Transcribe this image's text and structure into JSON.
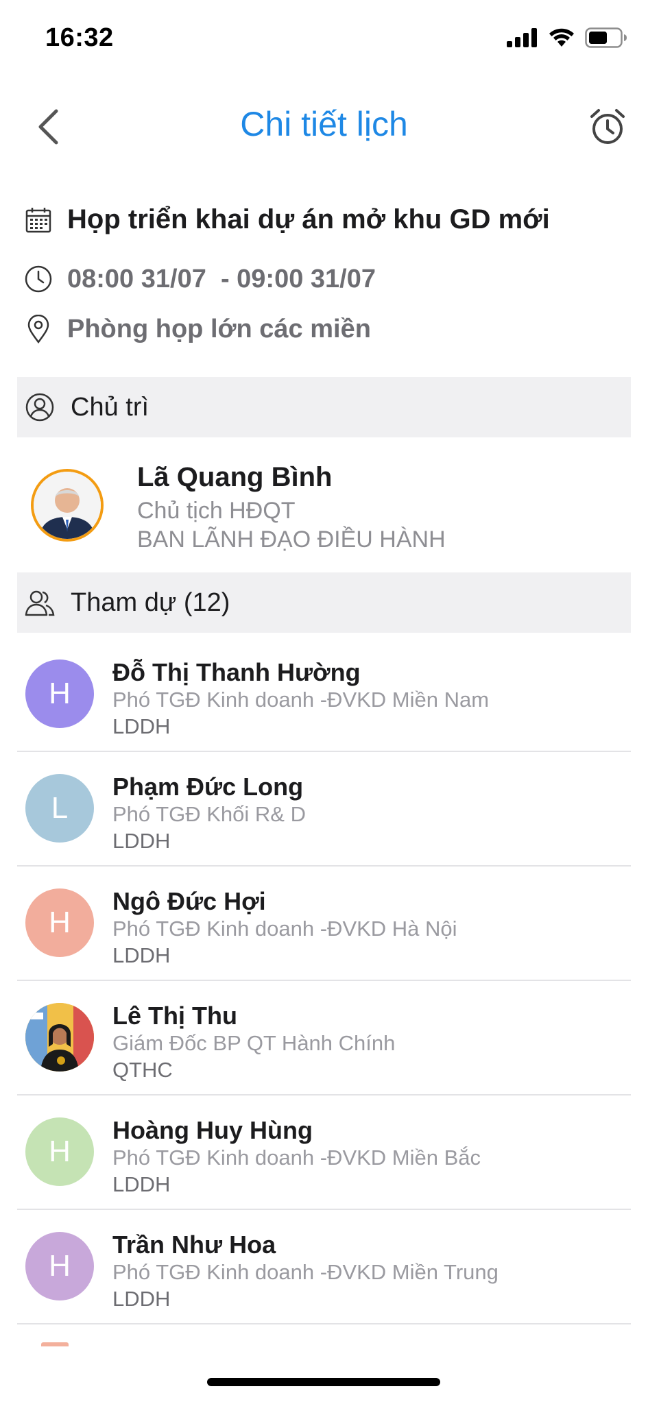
{
  "status_bar": {
    "time": "16:32"
  },
  "nav": {
    "title": "Chi tiết lịch",
    "back_icon": "chevron-left-icon",
    "alarm_icon": "alarm-clock-icon"
  },
  "event": {
    "title": "Họp triển khai dự án mở khu GD mới",
    "time": "08:00 31/07  - 09:00 31/07",
    "location": "Phòng họp lớn các miền"
  },
  "host_section": {
    "label": "Chủ trì"
  },
  "host": {
    "name": "Lã Quang Bình",
    "role": "Chủ tịch HĐQT",
    "department": "BAN LÃNH ĐẠO ĐIỀU HÀNH"
  },
  "attendees_section": {
    "label": "Tham dự (12)"
  },
  "attendees": [
    {
      "initial": "H",
      "color": "#9b8cec",
      "name": "Đỗ Thị Thanh Hường",
      "role": "Phó TGĐ Kinh doanh -ĐVKD Miền Nam",
      "department": "LDDH"
    },
    {
      "initial": "L",
      "color": "#a7c8db",
      "name": "Phạm Đức Long",
      "role": "Phó TGĐ Khối R& D",
      "department": "LDDH"
    },
    {
      "initial": "H",
      "color": "#f2ad9c",
      "name": "Ngô Đức Hợi",
      "role": "Phó TGĐ Kinh doanh -ĐVKD Hà Nội",
      "department": "LDDH"
    },
    {
      "initial": "",
      "color": "#3a4a6a",
      "name": "Lê Thị Thu",
      "role": "Giám Đốc BP QT Hành Chính",
      "department": "QTHC",
      "photo": true
    },
    {
      "initial": "H",
      "color": "#c5e3b4",
      "name": "Hoàng Huy Hùng",
      "role": "Phó TGĐ Kinh doanh -ĐVKD Miền Bắc",
      "department": "LDDH"
    },
    {
      "initial": "H",
      "color": "#c8a8da",
      "name": "Trần Như Hoa",
      "role": "Phó TGĐ Kinh doanh -ĐVKD Miền Trung",
      "department": "LDDH"
    }
  ]
}
